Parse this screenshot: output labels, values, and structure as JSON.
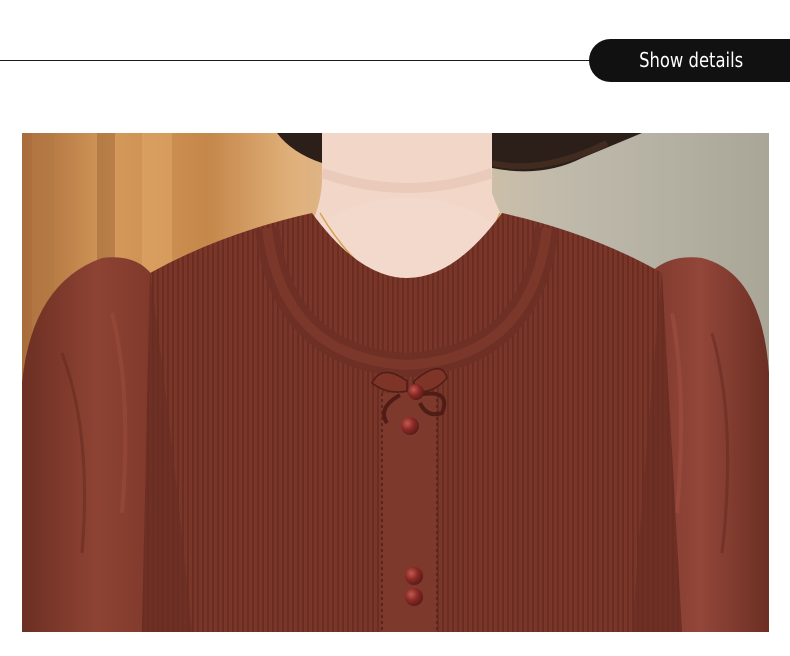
{
  "header": {
    "tab_label": "Show details"
  },
  "photo": {
    "subject": "product-photo",
    "colors": {
      "garment": "#7a3a2c",
      "garment_dark": "#5e2a20",
      "sleeve": "#843c2c",
      "skin": "#f3d9cc",
      "hair": "#2c1e18",
      "background_wood": "#c98a4b",
      "background_blur": "#b9b3a7",
      "button": "#8a2f2a"
    }
  }
}
